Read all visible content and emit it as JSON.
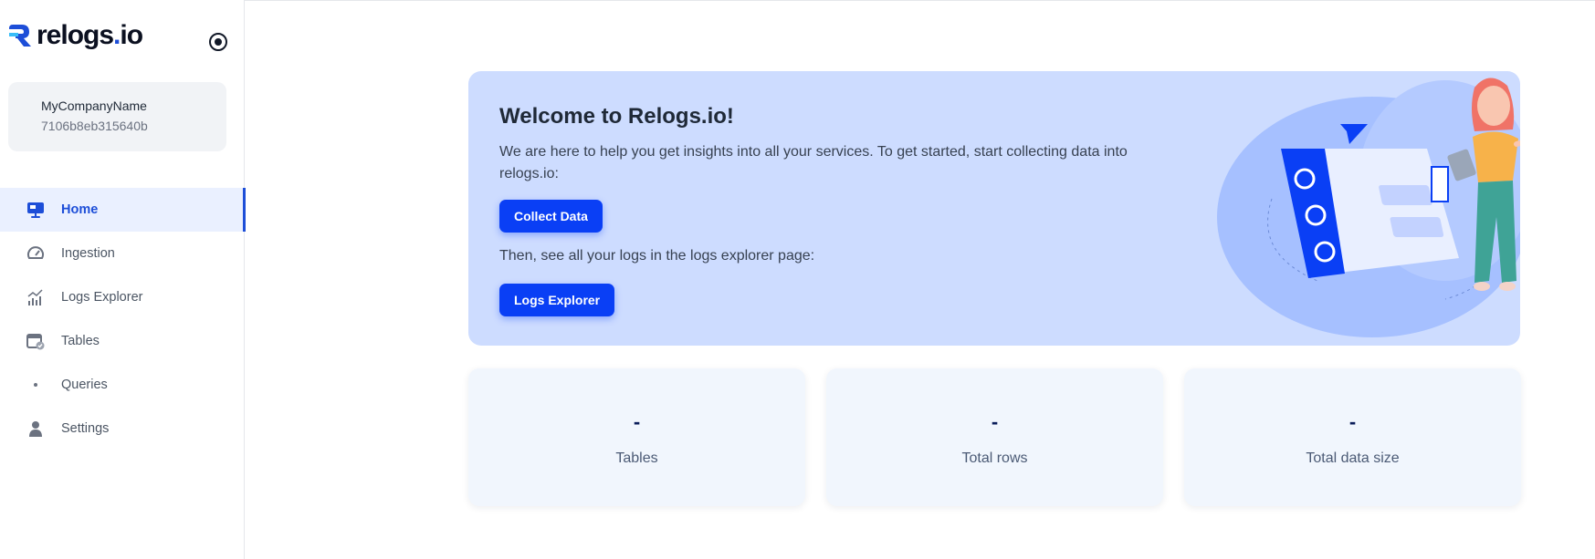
{
  "brand": {
    "name_part1": "relogs",
    "name_dot": ".",
    "name_part2": "io",
    "accent_color": "#1d4ed8"
  },
  "account": {
    "name": "MyCompanyName",
    "id": "7106b8eb315640b"
  },
  "nav": {
    "items": [
      {
        "label": "Home",
        "icon": "monitor-icon",
        "active": true
      },
      {
        "label": "Ingestion",
        "icon": "gauge-icon",
        "active": false
      },
      {
        "label": "Logs Explorer",
        "icon": "chart-icon",
        "active": false
      },
      {
        "label": "Tables",
        "icon": "calendar-check-icon",
        "active": false
      },
      {
        "label": "Queries",
        "icon": "dot-icon",
        "active": false
      },
      {
        "label": "Settings",
        "icon": "user-icon",
        "active": false
      }
    ]
  },
  "hero": {
    "title": "Welcome to Relogs.io!",
    "intro": "We are here to help you get insights into all your services. To get started, start collecting data into relogs.io:",
    "collect_button": "Collect Data",
    "explorer_text": "Then, see all your logs in the logs explorer page:",
    "explorer_button": "Logs Explorer",
    "background_color": "#cddcff",
    "button_color": "#0a3ff5"
  },
  "stats": [
    {
      "value": "-",
      "label": "Tables"
    },
    {
      "value": "-",
      "label": "Total rows"
    },
    {
      "value": "-",
      "label": "Total data size"
    }
  ]
}
